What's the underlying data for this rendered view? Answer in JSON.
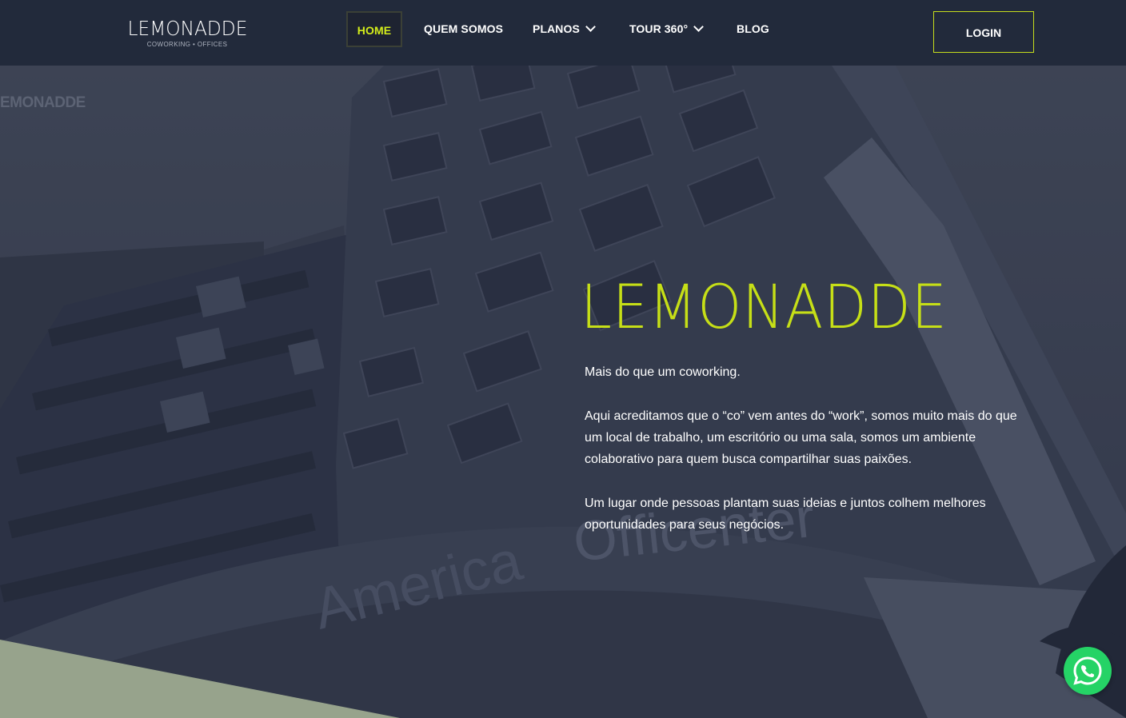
{
  "brand": {
    "name": "LEMONADDE",
    "tagline": "COWORKING • OFFICES"
  },
  "nav": {
    "items": [
      {
        "label": "HOME",
        "active": true
      },
      {
        "label": "QUEM SOMOS"
      },
      {
        "label": "PLANOS",
        "has_dropdown": true
      },
      {
        "label": "TOUR 360°",
        "has_dropdown": true
      },
      {
        "label": "BLOG"
      }
    ],
    "login_label": "LOGIN"
  },
  "hero": {
    "watermark": "EMONADDE",
    "sign_text": "America Officenter",
    "title": "LEMONADDE",
    "paragraphs": [
      "Mais do que um coworking.",
      "Aqui acreditamos que o “co” vem antes do “work”, somos muito mais do que um local de trabalho, um escritório ou uma sala, somos um ambiente colaborativo para quem busca compartilhar suas paixões.",
      "Um lugar onde pessoas plantam suas ideias e juntos colhem melhores oportunidades para seus negócios."
    ]
  },
  "colors": {
    "accent": "#c6df17",
    "header_bg": "#222a3b",
    "whatsapp": "#25d366",
    "shape": "#97a38c"
  },
  "icons": {
    "whatsapp": "whatsapp-icon",
    "chevron": "chevron-down-icon"
  }
}
